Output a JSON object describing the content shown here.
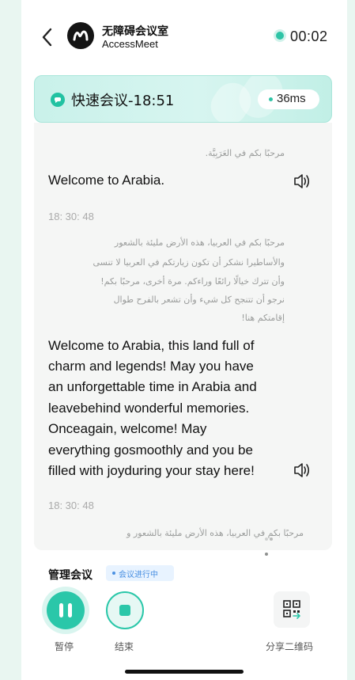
{
  "header": {
    "brand_cn": "无障碍会议室",
    "brand_en": "AccessMeet",
    "timer": "00:02"
  },
  "meeting": {
    "title": "快速会议-18:51",
    "latency": "36ms"
  },
  "transcript": {
    "entries": [
      {
        "arabic": "مرحبًا بكم في العَرَبِيَّة.",
        "english": "Welcome to Arabia."
      },
      {
        "timestamp": "18: 30: 48",
        "arabic_lines": [
          "مرحبًا بكم في العربيا، هذه الأرض مليئة بالشعور",
          "والأساطيرا نشكر أن تكون زيارتكم في العربيا لا تنسى",
          "وأن تترك خيالًا رائعًا وراءكم. مرة أخرى، مرحبًا بكم!",
          "نرجو أن تتنجح كل شيء وأن تشعر بالفرح طوال",
          "إقامتكم هنا!"
        ],
        "english_lines": [
          "Welcome to Arabia, this land full of",
          "charm and legends! May you have",
          "an unforgettable time in Arabia and",
          "leavebehind wonderful memories.",
          "Onceagain, welcome! May",
          "everything gosmoothly and you be",
          "filled with joyduring your stay here!"
        ]
      },
      {
        "timestamp": "18: 30: 48",
        "arabic": "مرحبًا بكم في العربيا، هذه الأرض مليئة بالشعور و"
      }
    ]
  },
  "controls": {
    "section_label": "管理会议",
    "status_badge": "会议进行中",
    "pause_label": "暂停",
    "end_label": "结束",
    "share_label": "分享二维码"
  },
  "colors": {
    "accent": "#2ac7a9",
    "badge_blue": "#4a90e2",
    "background": "#e9f6f1"
  },
  "icons": {
    "back": "chevron-left-icon",
    "logo": "accessmeet-logo",
    "speaker": "speaker-icon",
    "pause": "pause-icon",
    "stop": "stop-icon",
    "qr": "qr-code-icon"
  }
}
